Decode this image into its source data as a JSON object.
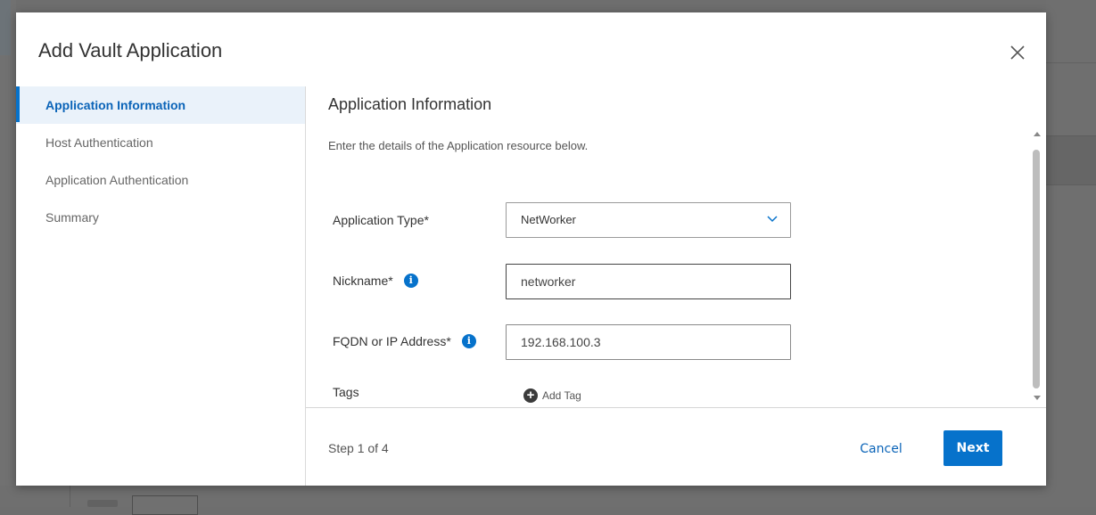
{
  "dialog": {
    "title": "Add Vault Application"
  },
  "nav": {
    "items": [
      {
        "label": "Application Information",
        "active": true
      },
      {
        "label": "Host Authentication",
        "active": false
      },
      {
        "label": "Application Authentication",
        "active": false
      },
      {
        "label": "Summary",
        "active": false
      }
    ]
  },
  "content": {
    "title": "Application Information",
    "description": "Enter the details of the Application resource below.",
    "fields": {
      "app_type": {
        "label": "Application Type*",
        "value": "NetWorker"
      },
      "nickname": {
        "label": "Nickname*",
        "value": "networker"
      },
      "fqdn": {
        "label": "FQDN or IP Address*",
        "value": "192.168.100.3"
      },
      "tags": {
        "label": "Tags",
        "add_label": "Add Tag"
      }
    }
  },
  "footer": {
    "step": "Step 1 of 4",
    "cancel_label": "Cancel",
    "next_label": "Next"
  },
  "colors": {
    "accent": "#0672cb",
    "nav_active_bg": "#eaf2fa"
  },
  "icons": {
    "close": "close-icon",
    "info": "info-icon",
    "chevron": "chevron-down-icon",
    "add": "plus-circle-icon"
  }
}
